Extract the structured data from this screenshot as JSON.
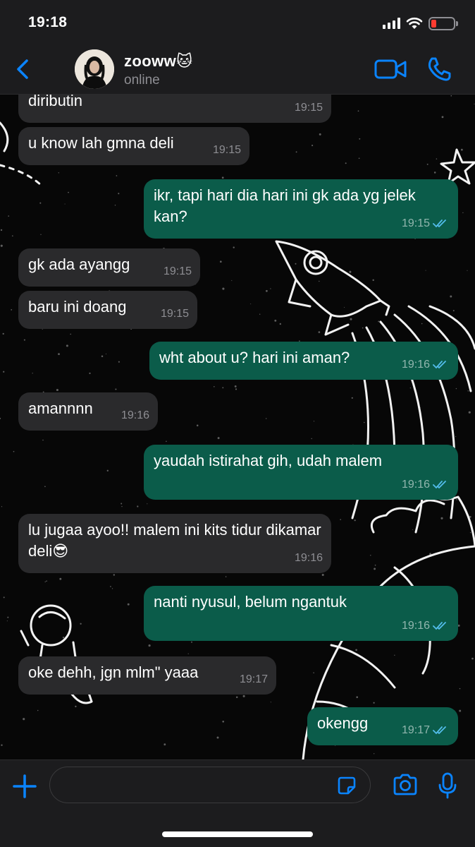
{
  "status_bar": {
    "time": "19:18"
  },
  "header": {
    "contact_name": "zooww🐱",
    "contact_status": "online",
    "accent_color": "#0a84ff"
  },
  "messages": [
    {
      "direction": "in",
      "text": "diributin",
      "time": "19:15"
    },
    {
      "direction": "in",
      "text": "u know lah gmna deli",
      "time": "19:15"
    },
    {
      "direction": "out",
      "text": "ikr, tapi hari dia hari ini gk ada yg jelek kan?",
      "time": "19:15",
      "read": true
    },
    {
      "direction": "in",
      "text": "gk ada ayangg",
      "time": "19:15"
    },
    {
      "direction": "in",
      "text": "baru ini doang",
      "time": "19:15"
    },
    {
      "direction": "out",
      "text": "wht about u? hari ini aman?",
      "time": "19:16",
      "read": true
    },
    {
      "direction": "in",
      "text": "amannnn",
      "time": "19:16"
    },
    {
      "direction": "out",
      "text": "yaudah istirahat gih, udah malem",
      "time": "19:16",
      "read": true
    },
    {
      "direction": "in",
      "text": "lu jugaa ayoo!! malem ini kits tidur dikamar deli😎",
      "time": "19:16"
    },
    {
      "direction": "out",
      "text": "nanti nyusul, belum ngantuk",
      "time": "19:16",
      "read": true
    },
    {
      "direction": "in",
      "text": "oke dehh, jgn mlm\" yaaa",
      "time": "19:17"
    },
    {
      "direction": "out",
      "text": "okengg",
      "time": "19:17",
      "read": true
    }
  ],
  "input_bar": {
    "value": "",
    "placeholder": ""
  },
  "colors": {
    "incoming_bubble": "#2a2a2c",
    "outgoing_bubble": "#0b5c4a",
    "read_ticks": "#53bdeb"
  }
}
